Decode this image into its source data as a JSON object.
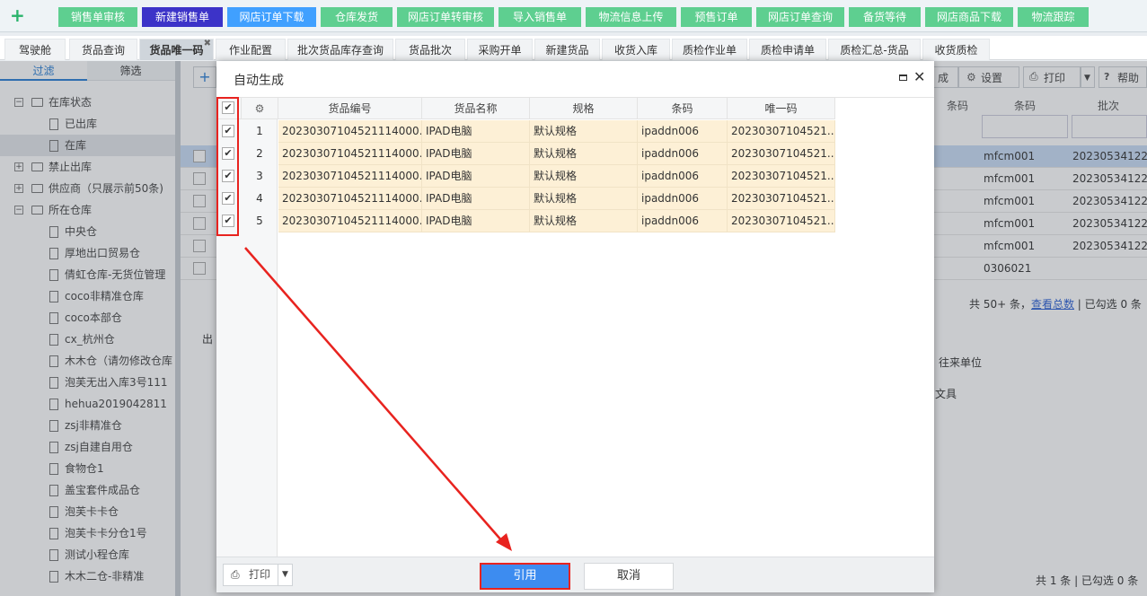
{
  "top_tabs": [
    "销售单审核",
    "新建销售单",
    "网店订单下载",
    "仓库发货",
    "网店订单转审核",
    "导入销售单",
    "物流信息上传",
    "预售订单",
    "网店订单查询",
    "备货等待",
    "网店商品下载",
    "物流跟踪"
  ],
  "page_tabs": [
    "驾驶舱",
    "货品查询",
    "货品唯一码",
    "作业配置",
    "批次货品库存查询",
    "货品批次",
    "采购开单",
    "新建货品",
    "收货入库",
    "质检作业单",
    "质检申请单",
    "质检汇总-货品",
    "收货质检"
  ],
  "sidebar": {
    "tab_filter": "过滤",
    "tab_select": "筛选",
    "tree": [
      {
        "label": "在库状态",
        "level": 0,
        "pm": "⊟"
      },
      {
        "label": "已出库",
        "level": 1
      },
      {
        "label": "在库",
        "level": 1,
        "selected": true
      },
      {
        "label": "禁止出库",
        "level": 0,
        "pm": "⊞"
      },
      {
        "label": "供应商（只展示前50条)",
        "level": 0,
        "pm": "⊞"
      },
      {
        "label": "所在仓库",
        "level": 0,
        "pm": "⊟"
      },
      {
        "label": "中央仓",
        "level": 1
      },
      {
        "label": "厚地出口贸易仓",
        "level": 1
      },
      {
        "label": "倩虹仓库-无货位管理",
        "level": 1
      },
      {
        "label": "coco非精准仓库",
        "level": 1
      },
      {
        "label": "coco本部仓",
        "level": 1
      },
      {
        "label": "cx_杭州仓",
        "level": 1
      },
      {
        "label": "木木仓（请勿修改仓库",
        "level": 1
      },
      {
        "label": "泡芙无出入库3号111",
        "level": 1
      },
      {
        "label": "hehua2019042811",
        "level": 1
      },
      {
        "label": "zsj非精准仓",
        "level": 1
      },
      {
        "label": "zsj自建自用仓",
        "level": 1
      },
      {
        "label": "食物仓1",
        "level": 1
      },
      {
        "label": "盖宝套件成品仓",
        "level": 1
      },
      {
        "label": "泡芙卡卡仓",
        "level": 1
      },
      {
        "label": "泡芙卡卡分仓1号",
        "level": 1
      },
      {
        "label": "测试小程仓库",
        "level": 1
      },
      {
        "label": "木木二仓-非精准",
        "level": 1
      }
    ]
  },
  "background": {
    "btn_settings": "设置",
    "btn_print": "打印",
    "btn_help": "帮助",
    "btn_partial": "成",
    "col_barcode": "条码",
    "col_batch": "批次",
    "rows": [
      {
        "barcode": "mfcm001",
        "batch": "20230534122"
      },
      {
        "barcode": "mfcm001",
        "batch": "20230534122"
      },
      {
        "barcode": "mfcm001",
        "batch": "20230534122"
      },
      {
        "barcode": "mfcm001",
        "batch": "20230534122"
      },
      {
        "barcode": "mfcm001",
        "batch": "20230534122"
      },
      {
        "barcode": "0306021",
        "batch": ""
      }
    ],
    "summary_prefix": "共 50+ 条，",
    "summary_link": "查看总数",
    "summary_suffix": " | 已勾选 0 条",
    "col_unit": "往来单位",
    "unit_value": "文具",
    "partial_out": "出",
    "bottom_summary": "共 1 条 | 已勾选 0 条"
  },
  "dialog": {
    "title": "自动生成",
    "columns": [
      "货品编号",
      "货品名称",
      "规格",
      "条码",
      "唯一码"
    ],
    "rows": [
      {
        "no": "1",
        "code": "20230307104521114000...",
        "name": "IPAD电脑",
        "spec": "默认规格",
        "barcode": "ipaddn006",
        "uid": "20230307104521..."
      },
      {
        "no": "2",
        "code": "20230307104521114000...",
        "name": "IPAD电脑",
        "spec": "默认规格",
        "barcode": "ipaddn006",
        "uid": "20230307104521..."
      },
      {
        "no": "3",
        "code": "20230307104521114000...",
        "name": "IPAD电脑",
        "spec": "默认规格",
        "barcode": "ipaddn006",
        "uid": "20230307104521..."
      },
      {
        "no": "4",
        "code": "20230307104521114000...",
        "name": "IPAD电脑",
        "spec": "默认规格",
        "barcode": "ipaddn006",
        "uid": "20230307104521..."
      },
      {
        "no": "5",
        "code": "20230307104521114000...",
        "name": "IPAD电脑",
        "spec": "默认规格",
        "barcode": "ipaddn006",
        "uid": "20230307104521..."
      }
    ],
    "print_label": "打印",
    "ok_label": "引用",
    "cancel_label": "取消"
  },
  "colors": {
    "accent": "#3d8cf0",
    "highlight": "#e8231f",
    "row_bg": "#fdf0d6",
    "top_tab": "#5ecf90"
  }
}
